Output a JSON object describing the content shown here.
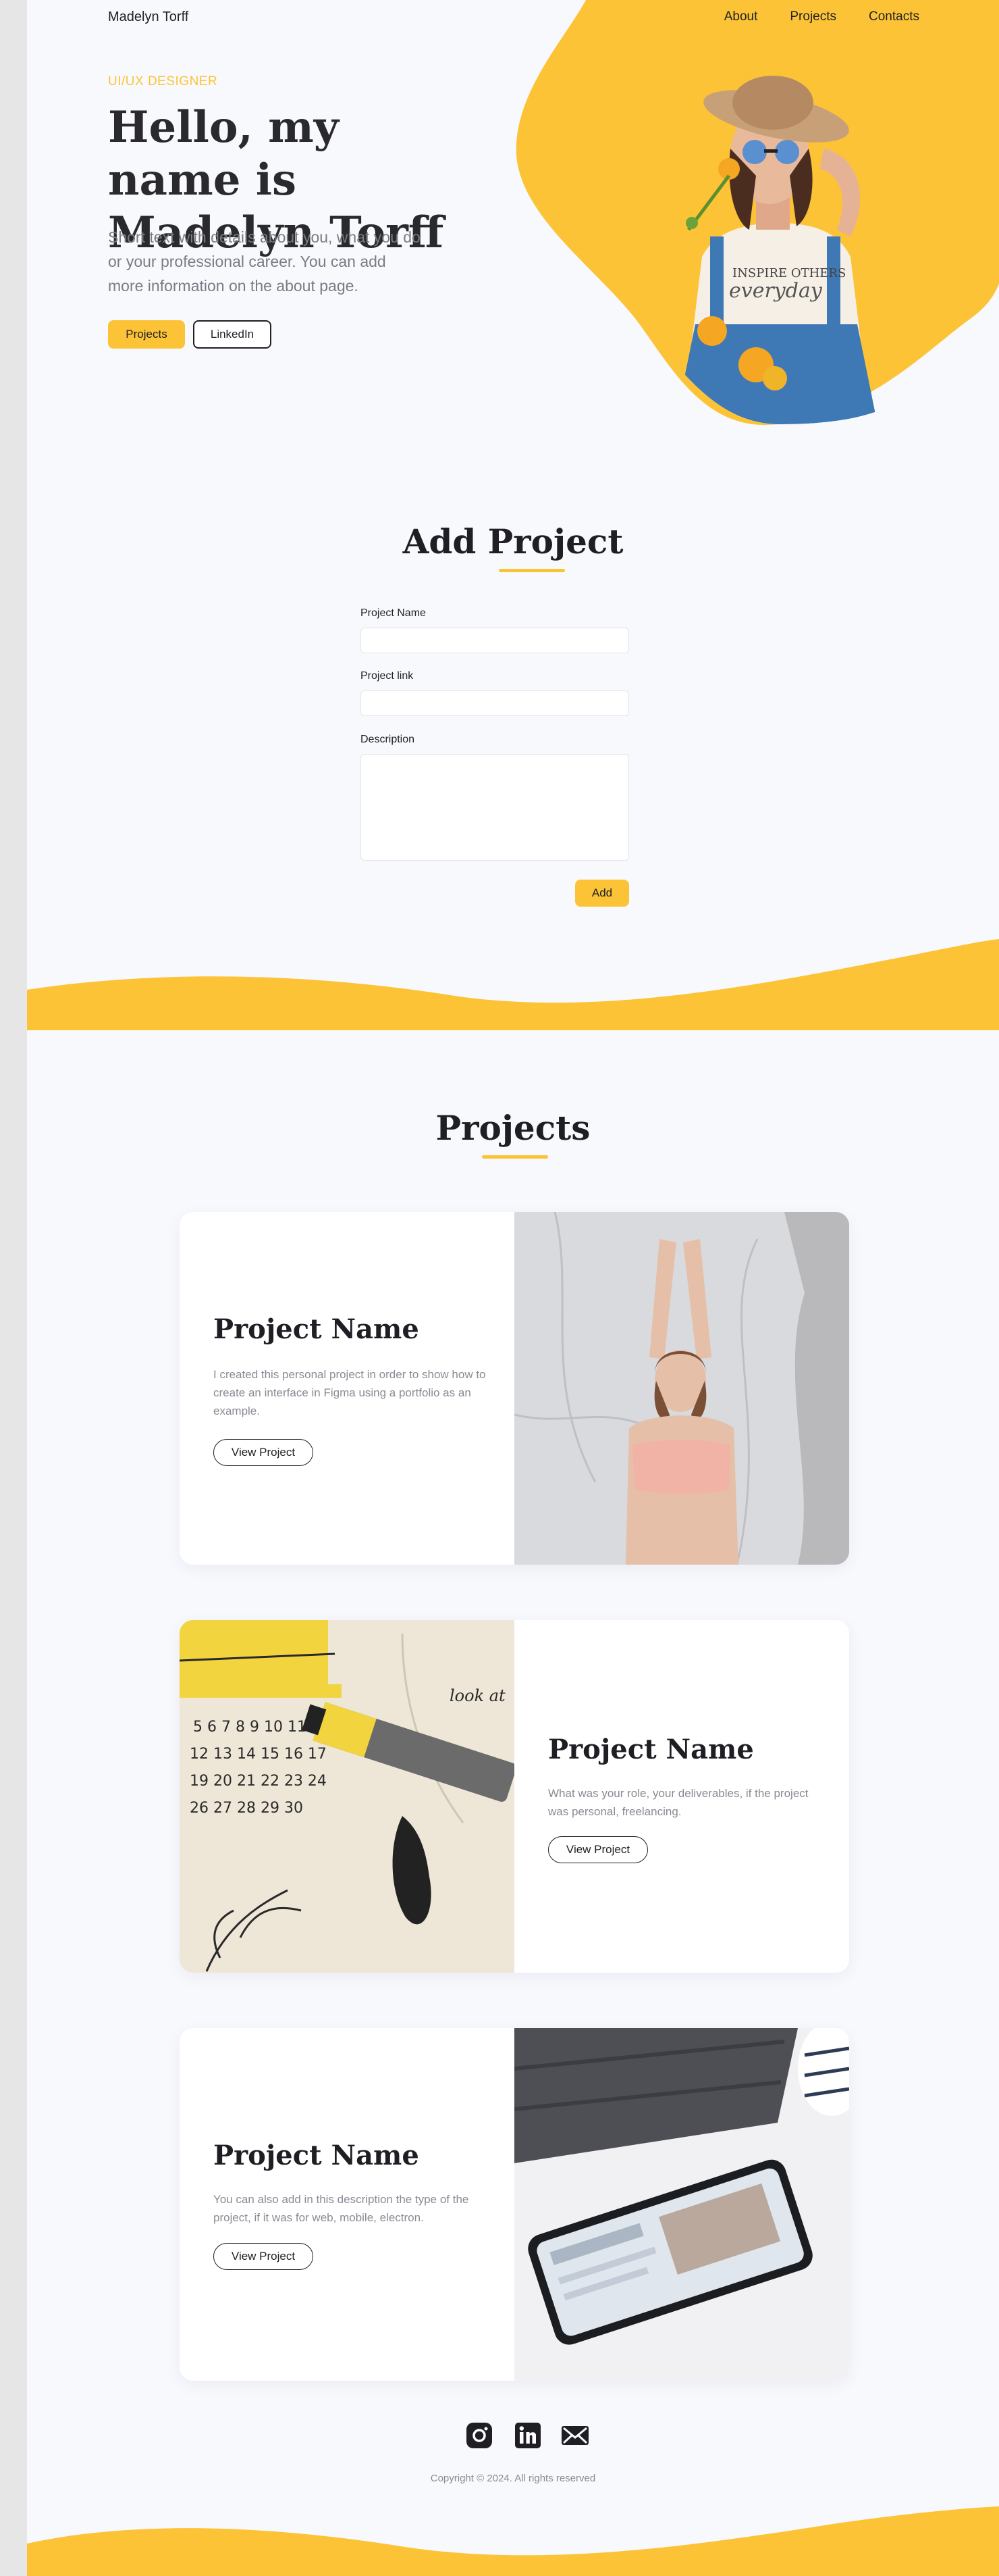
{
  "header": {
    "brand": "Madelyn Torff",
    "nav": [
      "About",
      "Projects",
      "Contacts"
    ]
  },
  "hero": {
    "eyebrow": "UI/UX DESIGNER",
    "title": "Hello,  my name is Madelyn Torff",
    "text": "Short text with details about you, what you do or your professional career. You can add more information on the about page.",
    "primary_button": "Projects",
    "secondary_button": "LinkedIn"
  },
  "add_project": {
    "title": "Add Project",
    "name_label": "Project Name",
    "link_label": "Project link",
    "description_label": "Description",
    "submit": "Add"
  },
  "projects": {
    "title": "Projects",
    "items": [
      {
        "name": "Project Name",
        "description": "I created this personal project in order to show how to create an interface in Figma using a portfolio as an example.",
        "button": "View Project",
        "image": "yoga-photo"
      },
      {
        "name": "Project Name",
        "description": "What was your role, your deliverables, if the project was personal, freelancing.",
        "button": "View Project",
        "image": "calendar-marker-photo"
      },
      {
        "name": "Project Name",
        "description": "You can also add in this description the type of the project, if it was for web, mobile, electron.",
        "button": "View Project",
        "image": "phone-desk-photo"
      }
    ]
  },
  "footer": {
    "social": [
      "instagram-icon",
      "linkedin-icon",
      "mail-icon"
    ],
    "copyright": "Copyright © 2024.  All rights reserved"
  },
  "colors": {
    "accent": "#fcc337",
    "text": "#1e1e24",
    "muted": "#8a8a94",
    "background": "#f8f9fd"
  }
}
